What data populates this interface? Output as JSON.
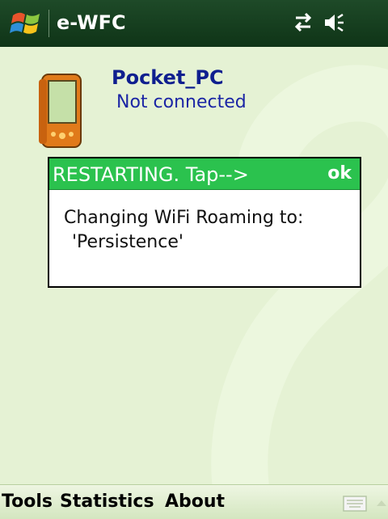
{
  "titlebar": {
    "app_title": "e-WFC",
    "start_icon": "windows-flag-icon",
    "connectivity_icon": "connectivity-arrows-icon",
    "volume_icon": "speaker-icon",
    "background_color": "#0f3417"
  },
  "device": {
    "name": "Pocket_PC",
    "status": "Not connected",
    "icon": "pocket-pc-device-icon"
  },
  "dialog": {
    "title": "RESTARTING. Tap-->",
    "ok_label": "ok",
    "message_line1": "Changing WiFi Roaming to:",
    "message_line2": "'Persistence'",
    "header_color": "#2bc24e"
  },
  "menubar": {
    "items": [
      "Tools",
      "Statistics",
      "About"
    ],
    "keyboard_icon": "keyboard-icon",
    "up_icon": "up-arrow-icon"
  },
  "colors": {
    "main_background": "#e5f2d4",
    "device_name": "#0f1f8f"
  }
}
